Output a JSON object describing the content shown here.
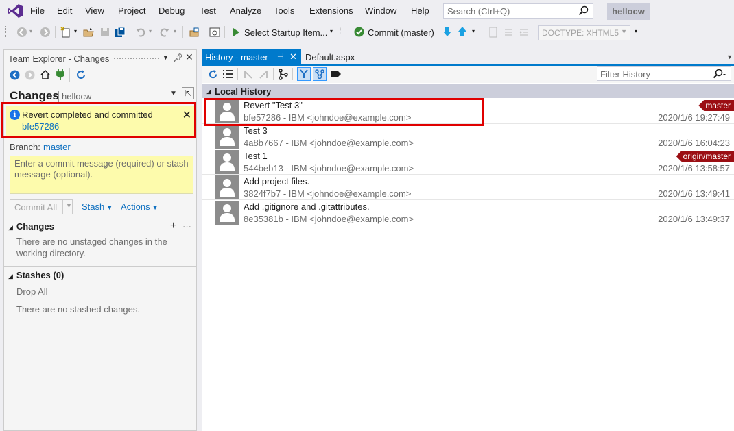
{
  "menu": {
    "items": [
      "File",
      "Edit",
      "View",
      "Project",
      "Debug",
      "Test",
      "Analyze",
      "Tools",
      "Extensions",
      "Window",
      "Help"
    ],
    "search_placeholder": "Search (Ctrl+Q)",
    "solution_name": "hellocw"
  },
  "toolbar": {
    "startup_label": "Select Startup Item...",
    "commit_label": "Commit (master)",
    "doctype": "DOCTYPE: XHTML5"
  },
  "team_explorer": {
    "header_title": "Team Explorer - Changes",
    "page_title": "Changes",
    "repo_name": "hellocw",
    "notification": {
      "message": "Revert completed and committed",
      "sha": "bfe57286"
    },
    "branch_label": "Branch:",
    "branch_value": "master",
    "commit_placeholder": "Enter a commit message (required) or stash message (optional).",
    "commit_all_label": "Commit All",
    "stash_label": "Stash",
    "actions_label": "Actions",
    "changes_section": {
      "title": "Changes",
      "empty_text": "There are no unstaged changes in the working directory."
    },
    "stashes_section": {
      "title": "Stashes (0)",
      "drop_all": "Drop All",
      "empty_text": "There are no stashed changes."
    }
  },
  "tabs": {
    "active": "History - master",
    "other": "Default.aspx"
  },
  "history": {
    "filter_placeholder": "Filter History",
    "section_title": "Local History",
    "commits": [
      {
        "title": "Revert \"Test 3\"",
        "meta": "bfe57286 - IBM <johndoe@example.com>",
        "date": "2020/1/6 19:27:49",
        "tag": "master"
      },
      {
        "title": "Test 3",
        "meta": "4a8b7667 - IBM <johndoe@example.com>",
        "date": "2020/1/6 16:04:23",
        "tag": ""
      },
      {
        "title": "Test 1",
        "meta": "544beb13 - IBM <johndoe@example.com>",
        "date": "2020/1/6 13:58:57",
        "tag": "origin/master"
      },
      {
        "title": "Add project files.",
        "meta": "3824f7b7 - IBM <johndoe@example.com>",
        "date": "2020/1/6 13:49:41",
        "tag": ""
      },
      {
        "title": "Add .gitignore and .gitattributes.",
        "meta": "8e35381b - IBM <johndoe@example.com>",
        "date": "2020/1/6 13:49:37",
        "tag": ""
      }
    ]
  },
  "colors": {
    "accent": "#007acc",
    "tag_bg": "#9b0e13",
    "highlight": "#e00000",
    "notification_bg": "#fdfbac"
  }
}
